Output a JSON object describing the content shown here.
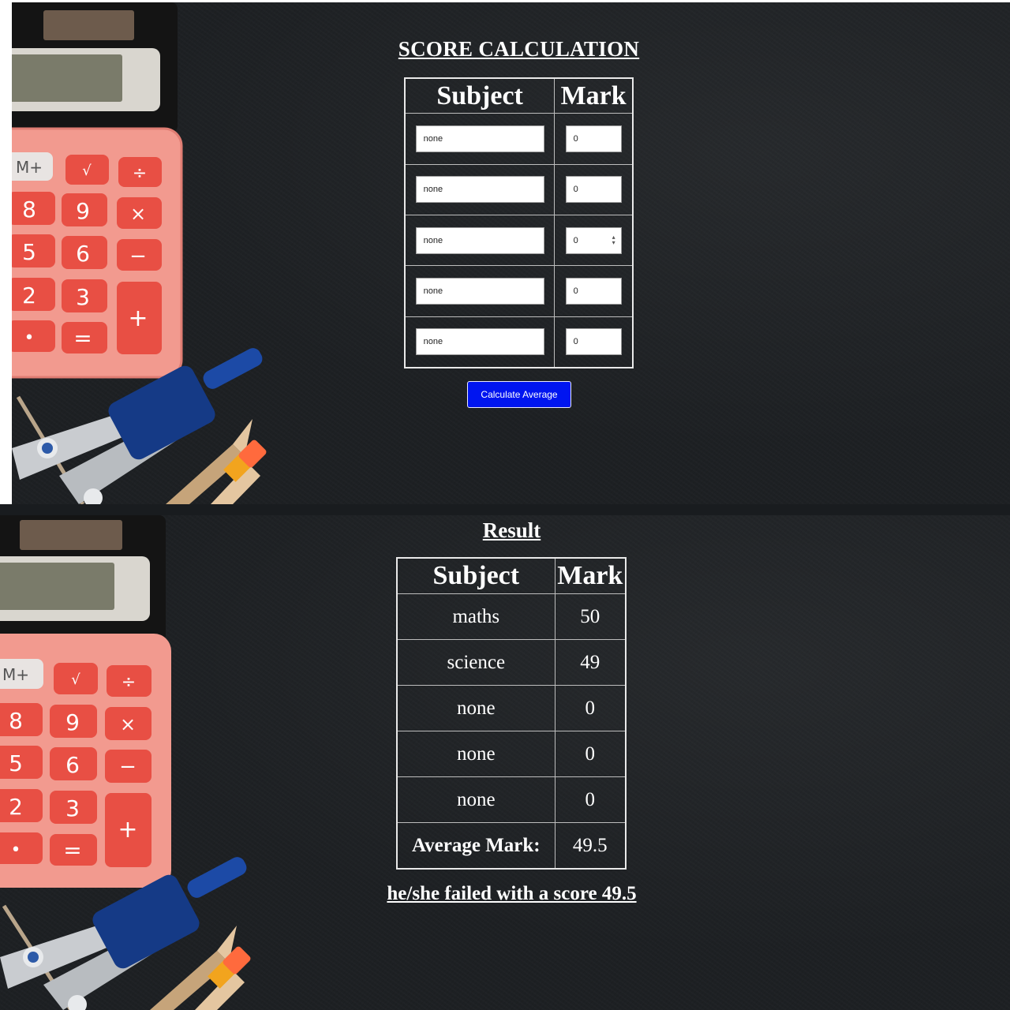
{
  "calculator_form": {
    "title": "SCORE CALCULATION",
    "header_subject": "Subject",
    "header_mark": "Mark",
    "rows": [
      {
        "subject": "none",
        "mark": "0"
      },
      {
        "subject": "none",
        "mark": "0"
      },
      {
        "subject": "none",
        "mark": "0"
      },
      {
        "subject": "none",
        "mark": "0"
      },
      {
        "subject": "none",
        "mark": "0"
      }
    ],
    "button_label": "Calculate Average",
    "colors": {
      "button_bg": "#0015f0",
      "text": "#ffffff",
      "background": "#1d2023"
    }
  },
  "result": {
    "title": "Result",
    "header_subject": "Subject",
    "header_mark": "Mark",
    "rows": [
      {
        "subject": "maths",
        "mark": "50"
      },
      {
        "subject": "science",
        "mark": "49"
      },
      {
        "subject": "none",
        "mark": "0"
      },
      {
        "subject": "none",
        "mark": "0"
      },
      {
        "subject": "none",
        "mark": "0"
      }
    ],
    "average_label": "Average Mark:",
    "average_value": "49.5",
    "message": "he/she failed with a score 49.5"
  },
  "decoration": {
    "calculator_keys": [
      "M+",
      "√",
      "÷",
      "8",
      "9",
      "×",
      "5",
      "6",
      "−",
      "2",
      "3",
      "+",
      "•",
      "="
    ]
  }
}
